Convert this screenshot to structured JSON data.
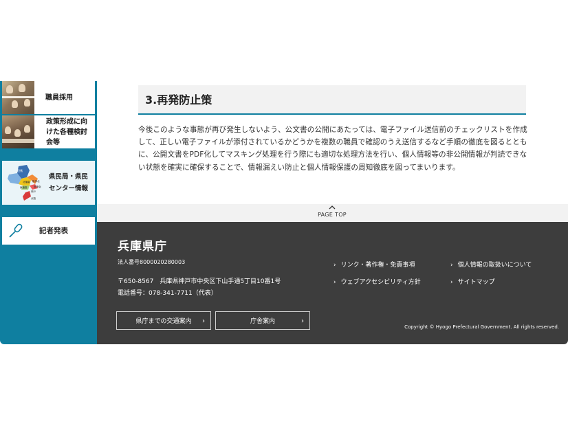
{
  "sidebar": {
    "recruit_label": "職員採用",
    "policy_label_lines": [
      "政策形成に向",
      "けた各種検討",
      "会等"
    ],
    "center_label_lines": [
      "県民局・県民",
      "センター情報"
    ],
    "press_label": "記者発表",
    "map_labels": [
      "阪神北",
      "阪神南",
      "東播磨",
      "北播磨",
      "神戸",
      "淡路"
    ]
  },
  "section": {
    "title": "3.再発防止策",
    "paragraph_lines": [
      "今後このような事態が再び発生しないよう、公文書の公開にあたっては、電子ファイル送信前のチェックリストを作成",
      "して、正しい電子ファイルが添付されているかどうかを複数の職員で確認のうえ送信するなど手順の徹底を図るととも",
      "に、公開文書をPDF化してマスキング処理を行う際にも適切な処理方法を行い、個人情報等の非公開情報が判読できな",
      "い状態を確実に確保することで、情報漏えい防止と個人情報保護の周知徹底を図ってまいります。"
    ]
  },
  "pagetop": {
    "label": "PAGE TOP"
  },
  "footer": {
    "title": "兵庫県庁",
    "corp_number": "法人番号8000020280003",
    "address": "〒650-8567　兵庫県神戸市中央区下山手通5丁目10番1号",
    "tel": "電話番号：078-341-7711（代表）",
    "buttons": {
      "access": "県庁までの交通案内",
      "office": "庁舎案内"
    },
    "links": {
      "link_copyright": "リンク・著作権・免責事項",
      "privacy": "個人情報の取扱いについて",
      "accessibility": "ウェブアクセシビリティ方針",
      "sitemap": "サイトマップ"
    },
    "copyright": "Copyright © Hyogo Prefectural Government. All rights reserved."
  },
  "colors": {
    "accent": "#0f7fa0",
    "footer_bg": "#3d3d3d",
    "section_bg": "#f2f2f2"
  }
}
